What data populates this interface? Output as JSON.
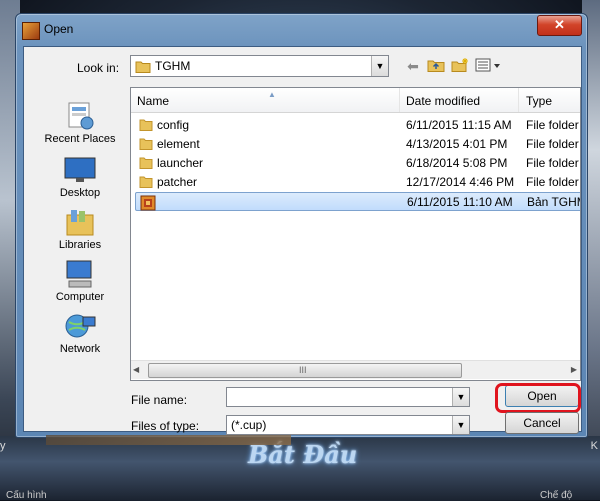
{
  "window": {
    "title": "Open",
    "close_glyph": "✕"
  },
  "toolbar": {
    "look_in_label": "Look in:",
    "look_in_value": "TGHM",
    "back_icon": "back-arrow-icon",
    "up_icon": "up-folder-icon",
    "new_folder_icon": "new-folder-icon",
    "view_icon": "view-menu-icon"
  },
  "places": [
    {
      "label": "Recent Places",
      "icon": "recent-places-icon"
    },
    {
      "label": "Desktop",
      "icon": "desktop-icon"
    },
    {
      "label": "Libraries",
      "icon": "libraries-icon"
    },
    {
      "label": "Computer",
      "icon": "computer-icon"
    },
    {
      "label": "Network",
      "icon": "network-icon"
    }
  ],
  "file_list": {
    "columns": [
      "Name",
      "Date modified",
      "Type"
    ],
    "rows": [
      {
        "name": "config",
        "date": "6/11/2015 11:15 AM",
        "type": "File folder",
        "icon": "folder-icon",
        "selected": false
      },
      {
        "name": "element",
        "date": "4/13/2015 4:01 PM",
        "type": "File folder",
        "icon": "folder-icon",
        "selected": false
      },
      {
        "name": "launcher",
        "date": "6/18/2014 5:08 PM",
        "type": "File folder",
        "icon": "folder-icon",
        "selected": false
      },
      {
        "name": "patcher",
        "date": "12/17/2014 4:46 PM",
        "type": "File folder",
        "icon": "folder-icon",
        "selected": false
      },
      {
        "name": "",
        "date": "6/11/2015 11:10 AM",
        "type": "Bản TGHM",
        "icon": "app-file-icon",
        "selected": true
      }
    ],
    "hscroll_grip": "III"
  },
  "form": {
    "file_name_label": "File name:",
    "file_name_value": "",
    "file_type_label": "Files of type:",
    "file_type_value": "(*.cup)"
  },
  "buttons": {
    "open": "Open",
    "cancel": "Cancel"
  },
  "background": {
    "title": "Bắt Đầu",
    "left_edge": "y",
    "right_edge": "K",
    "bottom_left": "Cấu hình",
    "bottom_right": "Chế độ"
  },
  "colors": {
    "highlight": "#e0141e",
    "selection": "#c1dcfc",
    "titlebar": "#6c93bd"
  }
}
